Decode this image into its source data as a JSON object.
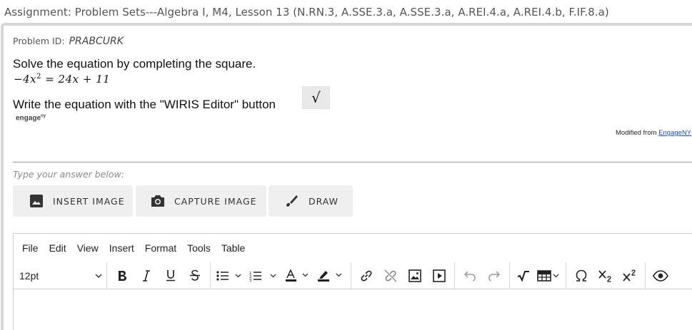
{
  "assignment": {
    "title": "Assignment: Problem Sets---Algebra I, M4, Lesson 13 (N.RN.3, A.SSE.3.a, A.SSE.3.a, A.REI.4.a, A.REI.4.b, F.IF.8.a)"
  },
  "problem": {
    "id_label": "Problem ID:",
    "id_value": "PRABCURK",
    "question": "Solve the equation by completing the square.",
    "equation_lhs": "−4x",
    "equation_exp": "2",
    "equation_rhs": " = 24x + 11",
    "instruction": "Write the equation with the \"WIRIS Editor\" button",
    "sqrt_symbol": "√",
    "logo_text": "engage",
    "logo_sup": "ny",
    "modified_prefix": "Modified from ",
    "modified_link": "EngageNY"
  },
  "answer": {
    "label": "Type your answer below:"
  },
  "image_buttons": {
    "insert": "INSERT IMAGE",
    "capture": "CAPTURE IMAGE",
    "draw": "DRAW"
  },
  "editor": {
    "menu": [
      "File",
      "Edit",
      "View",
      "Insert",
      "Format",
      "Tools",
      "Table"
    ],
    "font_size": "12pt",
    "toolbar_icons": [
      "bold-icon",
      "italic-icon",
      "underline-icon",
      "strikethrough-icon",
      "bullet-list-icon",
      "numbered-list-icon",
      "text-color-icon",
      "highlight-icon",
      "link-icon",
      "unlink-icon",
      "image-icon",
      "media-icon",
      "undo-icon",
      "redo-icon",
      "wiris-math-icon",
      "table-icon",
      "special-char-icon",
      "subscript-icon",
      "superscript-icon",
      "preview-icon"
    ]
  }
}
